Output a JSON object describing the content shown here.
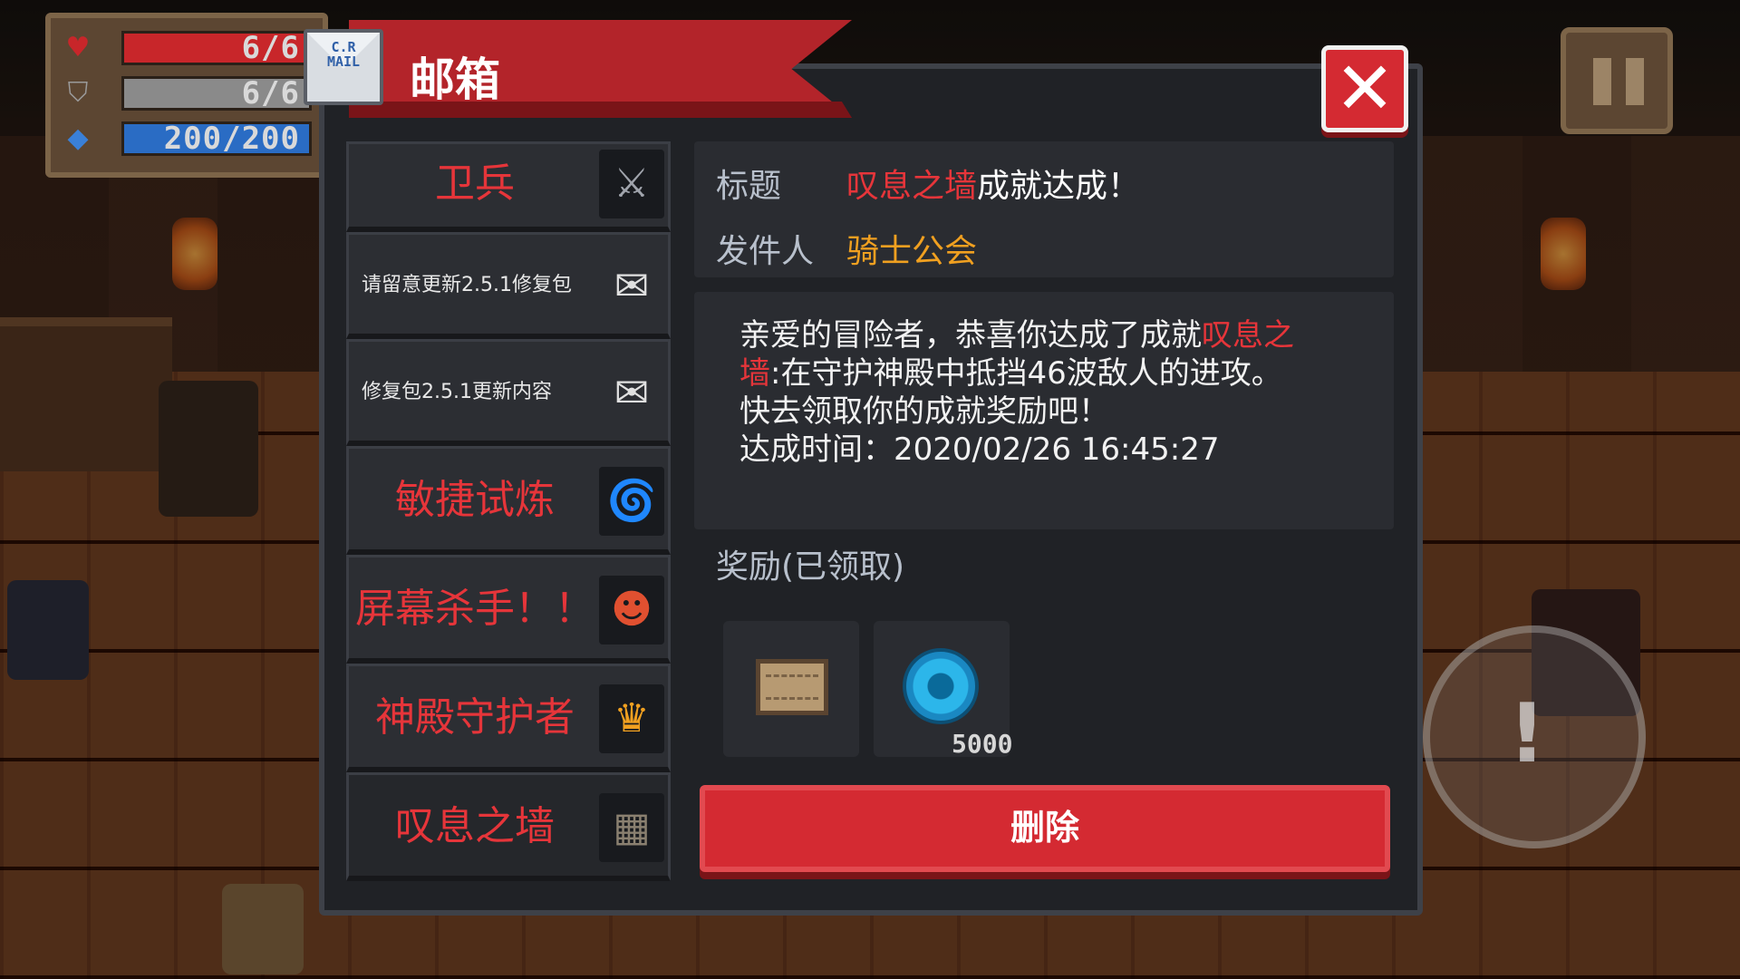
{
  "hud": {
    "hp": "6/6",
    "armor": "6/6",
    "energy": "200/200"
  },
  "mailbox": {
    "title": "邮箱",
    "icon_text": "C.R MAIL",
    "close_icon": "close-x-icon"
  },
  "mail_list": [
    {
      "label": "卫兵",
      "style": "red",
      "icon": "knight-helmet-icon"
    },
    {
      "label": "请留意更新2.5.1修复包",
      "style": "white",
      "icon": "envelope-icon"
    },
    {
      "label": "修复包2.5.1更新内容",
      "style": "white",
      "icon": "envelope-icon"
    },
    {
      "label": "敏捷试炼",
      "style": "red",
      "icon": "tornado-icon"
    },
    {
      "label": "屏幕杀手！！",
      "style": "red",
      "icon": "character-icon"
    },
    {
      "label": "神殿守护者",
      "style": "red",
      "icon": "temple-guardian-icon"
    },
    {
      "label": "叹息之墙",
      "style": "red",
      "icon": "wall-icon"
    }
  ],
  "detail": {
    "title_label": "标题",
    "title_highlight": "叹息之墙",
    "title_rest": "成就达成！",
    "sender_label": "发件人",
    "sender": "骑士公会",
    "body": {
      "line1_prefix": "亲爱的冒险者，恭喜你达成了成就",
      "line1_highlight": "叹息之",
      "line2_highlight": "墙",
      "line2_rest": ":在守护神殿中抵挡46波敌人的进攻。",
      "line3": "快去领取你的成就奖励吧！",
      "line4": "达成时间：2020/02/26 16:45:27"
    },
    "reward_title": "奖励(已领取)",
    "rewards": [
      {
        "icon": "scroll-icon"
      },
      {
        "icon": "blue-gem-icon",
        "count": "5000"
      }
    ],
    "delete_label": "删除"
  },
  "colors": {
    "accent_red": "#e6353a",
    "sender_gold": "#f0a020",
    "panel_bg": "#202226"
  }
}
